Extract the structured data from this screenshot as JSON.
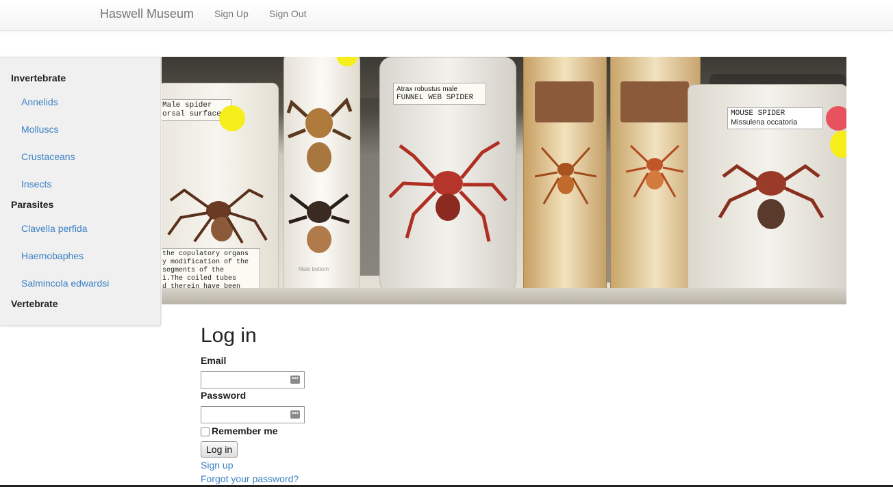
{
  "navbar": {
    "brand": "Haswell Museum",
    "links": [
      "Sign Up",
      "Sign Out"
    ]
  },
  "sidebar": {
    "categories": [
      {
        "label": "Invertebrate",
        "items": [
          "Annelids",
          "Molluscs",
          "Crustaceans",
          "Insects"
        ]
      },
      {
        "label": "Parasites",
        "items": [
          "Clavella perfida",
          "Haemobaphes",
          "Salmincola edwardsi"
        ]
      },
      {
        "label": "Vertebrate",
        "items": []
      }
    ]
  },
  "banner": {
    "labels": {
      "jar1": [
        "Male spider",
        "orsal surface"
      ],
      "jar1_bottom": [
        "the copulatory organs",
        "y modification of the",
        " segments of the",
        "i.The coiled tubes",
        "d therein have been"
      ],
      "jar3": [
        "Atrax robustus   male",
        "FUNNEL WEB SPIDER"
      ],
      "jar6": [
        "MOUSE SPIDER",
        "Missulena occatoria"
      ],
      "jar2_bottom": "Male  bottom"
    },
    "colors": {
      "yellow_dot": "#f5ee1a",
      "red_dot": "#e8525f"
    }
  },
  "login": {
    "title": "Log in",
    "email_label": "Email",
    "password_label": "Password",
    "remember_label": "Remember me",
    "submit_label": "Log in",
    "links": [
      "Sign up",
      "Forgot your password?"
    ]
  },
  "icons": {
    "autofill": "key-autofill-icon",
    "checkbox": "checkbox"
  }
}
